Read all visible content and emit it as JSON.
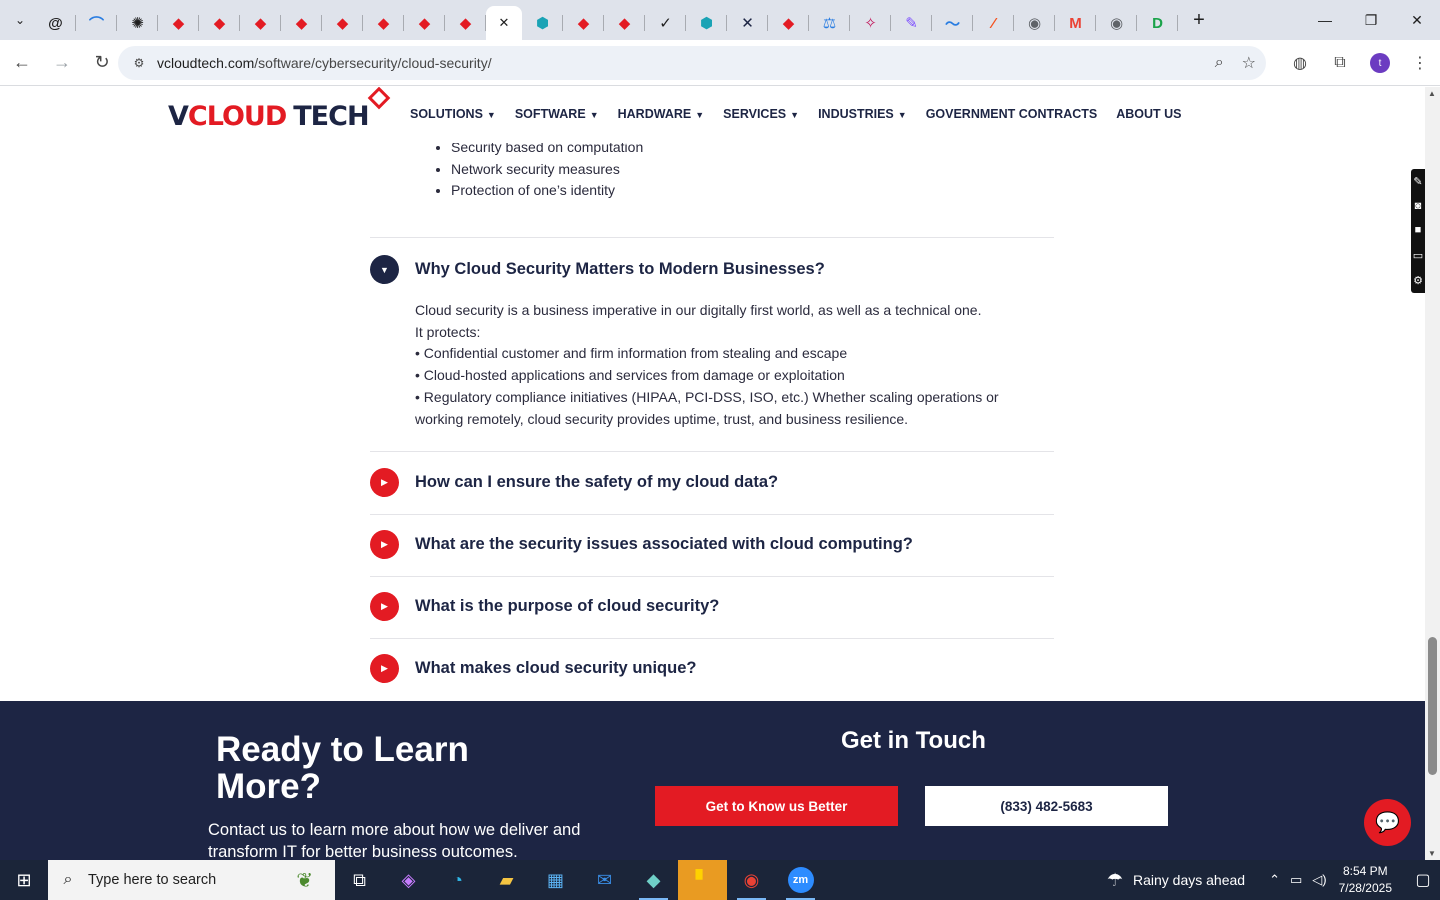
{
  "browser": {
    "tabs": [
      {
        "icon": "threads-icon",
        "glyph": "@",
        "color": "#1f1f1f"
      },
      {
        "icon": "arc-icon",
        "glyph": "⌒",
        "color": "#2a7de1"
      },
      {
        "icon": "openai-icon",
        "glyph": "✺",
        "color": "#1f1f1f"
      },
      {
        "icon": "vcloud-icon",
        "glyph": "◆",
        "color": "#e31b23"
      },
      {
        "icon": "vcloud-icon",
        "glyph": "◆",
        "color": "#e31b23"
      },
      {
        "icon": "vcloud-icon",
        "glyph": "◆",
        "color": "#e31b23"
      },
      {
        "icon": "vcloud-icon",
        "glyph": "◆",
        "color": "#e31b23"
      },
      {
        "icon": "vcloud-icon",
        "glyph": "◆",
        "color": "#e31b23"
      },
      {
        "icon": "vcloud-icon",
        "glyph": "◆",
        "color": "#e31b23"
      },
      {
        "icon": "vcloud-icon",
        "glyph": "◆",
        "color": "#e31b23"
      },
      {
        "icon": "vcloud-icon",
        "glyph": "◆",
        "color": "#e31b23"
      },
      {
        "icon": "active-tab-close-icon",
        "glyph": "✕",
        "color": "#1f1f1f",
        "active": true
      },
      {
        "icon": "hex-icon",
        "glyph": "⬢",
        "color": "#1aa3b5"
      },
      {
        "icon": "vcloud-icon",
        "glyph": "◆",
        "color": "#e31b23"
      },
      {
        "icon": "vcloud-icon",
        "glyph": "◆",
        "color": "#e31b23"
      },
      {
        "icon": "check-icon",
        "glyph": "✓",
        "color": "#1f1f1f"
      },
      {
        "icon": "hex-icon",
        "glyph": "⬢",
        "color": "#1aa3b5"
      },
      {
        "icon": "x-icon",
        "glyph": "✕",
        "color": "#1d2544"
      },
      {
        "icon": "vcloud-icon",
        "glyph": "◆",
        "color": "#e31b23"
      },
      {
        "icon": "scale-icon",
        "glyph": "⚖",
        "color": "#2a7de1"
      },
      {
        "icon": "spark-icon",
        "glyph": "✧",
        "color": "#c2185b"
      },
      {
        "icon": "pen-icon",
        "glyph": "✎",
        "color": "#7c4dff"
      },
      {
        "icon": "pulse-icon",
        "glyph": "〜",
        "color": "#2a7de1"
      },
      {
        "icon": "slash-icon",
        "glyph": "⁄",
        "color": "#f4511e"
      },
      {
        "icon": "globe-icon",
        "glyph": "◉",
        "color": "#5f6368"
      },
      {
        "icon": "gmail-icon",
        "glyph": "M",
        "color": "#ea4335"
      },
      {
        "icon": "globe-icon",
        "glyph": "◉",
        "color": "#5f6368"
      },
      {
        "icon": "d-icon",
        "glyph": "D",
        "color": "#1aa34a"
      }
    ],
    "url_host": "vcloudtech.com",
    "url_path": "/software/cybersecurity/cloud-security/",
    "profile_initial": "t"
  },
  "site": {
    "logo": {
      "v": "V",
      "cloud": "CLOUD",
      "tech": "TECH"
    },
    "nav": [
      {
        "label": "SOLUTIONS",
        "dropdown": true
      },
      {
        "label": "SOFTWARE",
        "dropdown": true
      },
      {
        "label": "HARDWARE",
        "dropdown": true
      },
      {
        "label": "SERVICES",
        "dropdown": true
      },
      {
        "label": "INDUSTRIES",
        "dropdown": true
      },
      {
        "label": "GOVERNMENT CONTRACTS",
        "dropdown": false
      },
      {
        "label": "ABOUT US",
        "dropdown": false
      }
    ]
  },
  "content": {
    "bullets": [
      "Security based on computation",
      "Network security measures",
      "Protection of one’s identity"
    ],
    "faq": [
      {
        "question": "Why Cloud Security Matters to Modern Businesses?",
        "open": true,
        "answer": [
          "Cloud security is a business imperative in our digitally first world, as well as a technical one.",
          "It protects:",
          "• Confidential customer and firm information from stealing and escape",
          "• Cloud-hosted applications and services from damage or exploitation",
          "• Regulatory compliance initiatives (HIPAA, PCI-DSS, ISO, etc.) Whether scaling operations or working remotely, cloud security provides uptime, trust, and business resilience."
        ]
      },
      {
        "question": "How can I ensure the safety of my cloud data?",
        "open": false
      },
      {
        "question": "What are the security issues associated with cloud computing?",
        "open": false
      },
      {
        "question": "What is the purpose of cloud security?",
        "open": false
      },
      {
        "question": "What makes cloud security unique?",
        "open": false
      }
    ]
  },
  "footer": {
    "heading": "Ready to Learn More?",
    "subtext": "Contact us to learn more about how we deliver and transform IT for better business outcomes.",
    "get_in_touch": "Get in Touch",
    "cta_button": "Get to Know us Better",
    "phone_button": "(833) 482-5683"
  },
  "taskbar": {
    "search_placeholder": "Type here to search",
    "weather": "Rainy days ahead",
    "time": "8:54 PM",
    "date": "7/28/2025"
  },
  "colors": {
    "brand_navy": "#1d2544",
    "brand_red": "#e31b23"
  }
}
